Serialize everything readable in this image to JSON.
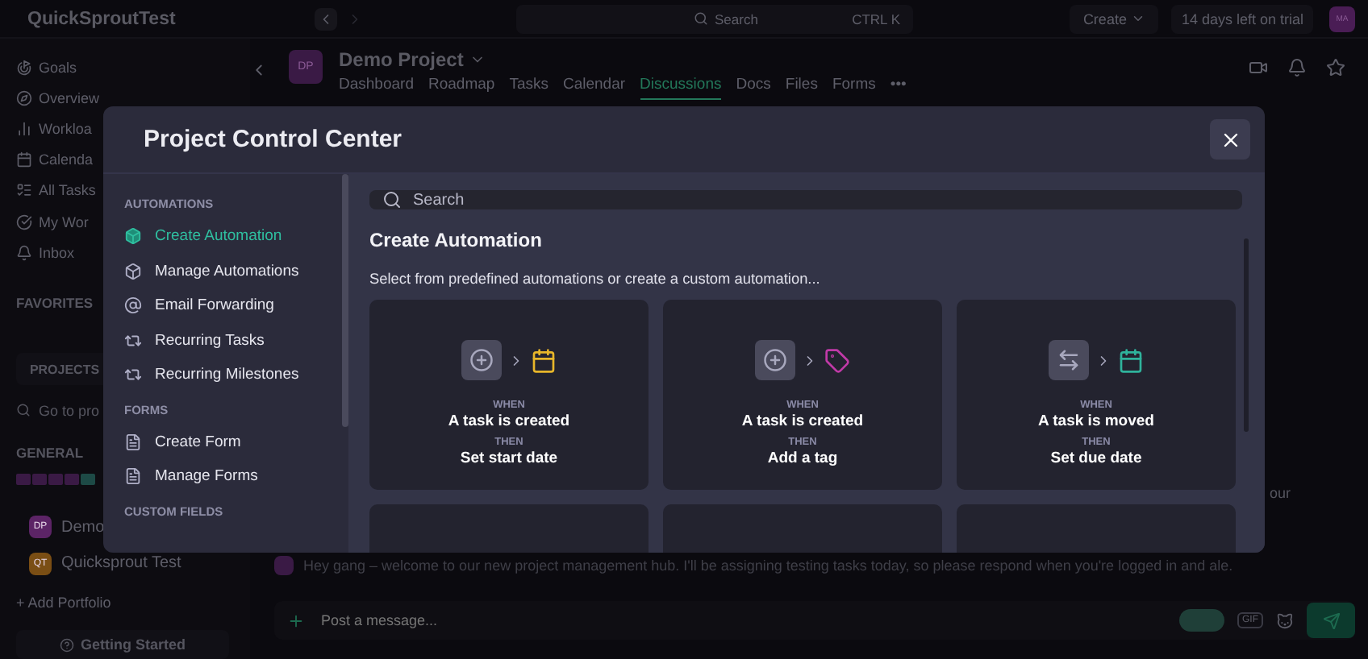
{
  "topbar": {
    "workspace": "QuickSproutTest",
    "search": {
      "placeholder": "Search",
      "shortcut": "CTRL K"
    },
    "create_button": "Create",
    "trial": "14 days left on trial",
    "avatar": "MA"
  },
  "sidebar": {
    "items": [
      {
        "label": "Goals"
      },
      {
        "label": "Overview"
      },
      {
        "label": "Workloa"
      },
      {
        "label": "Calenda"
      },
      {
        "label": "All Tasks"
      },
      {
        "label": "My Wor"
      },
      {
        "label": "Inbox"
      }
    ],
    "favorites": "FAVORITES",
    "projects_tab": "PROJECTS",
    "search": {
      "placeholder": "Go to pro"
    },
    "general": "GENERAL",
    "projects": [
      {
        "initials": "DP",
        "name": "Demo",
        "color": "#5c2466"
      },
      {
        "initials": "QT",
        "name": "Quicksprout Test",
        "color": "#7a4e14"
      }
    ],
    "add_portfolio": "+ Add Portfolio",
    "getting_started": "Getting Started"
  },
  "project": {
    "initials": "DP",
    "title": "Demo Project",
    "tabs": [
      {
        "label": "Dashboard",
        "selected": false
      },
      {
        "label": "Roadmap",
        "selected": false
      },
      {
        "label": "Tasks",
        "selected": false
      },
      {
        "label": "Calendar",
        "selected": false
      },
      {
        "label": "Discussions",
        "selected": true
      },
      {
        "label": "Docs",
        "selected": false
      },
      {
        "label": "Files",
        "selected": false
      },
      {
        "label": "Forms",
        "selected": false
      },
      {
        "label": "•••",
        "selected": false
      }
    ]
  },
  "discussion": {
    "message_fragment": "our",
    "message": "Hey gang – welcome to our new project management hub. I'll be assigning testing tasks today, so please respond when you're logged in and ale.",
    "composer": {
      "placeholder": "Post a message..."
    },
    "gif_button": "GIF"
  },
  "modal": {
    "title": "Project Control Center",
    "nav": [
      {
        "heading": "AUTOMATIONS",
        "items": [
          {
            "label": "Create Automation",
            "selected": true
          },
          {
            "label": "Manage Automations",
            "selected": false
          },
          {
            "label": "Email Forwarding",
            "selected": false
          },
          {
            "label": "Recurring Tasks",
            "selected": false
          },
          {
            "label": "Recurring Milestones",
            "selected": false
          }
        ]
      },
      {
        "heading": "FORMS",
        "items": [
          {
            "label": "Create Form",
            "selected": false
          },
          {
            "label": "Manage Forms",
            "selected": false
          }
        ]
      },
      {
        "heading": "CUSTOM FIELDS"
      }
    ],
    "search": {
      "placeholder": "Search"
    },
    "heading": "Create Automation",
    "subtitle": "Select from predefined automations or create a custom automation...",
    "cards": [
      {
        "when_label": "WHEN",
        "trigger": "A task is created",
        "then_label": "THEN",
        "action": "Set start date",
        "color": "#e8b62a"
      },
      {
        "when_label": "WHEN",
        "trigger": "A task is created",
        "then_label": "THEN",
        "action": "Add a tag",
        "color": "#c13aa8"
      },
      {
        "when_label": "WHEN",
        "trigger": "A task is moved",
        "then_label": "THEN",
        "action": "Set due date",
        "color": "#2fb39c"
      }
    ]
  }
}
